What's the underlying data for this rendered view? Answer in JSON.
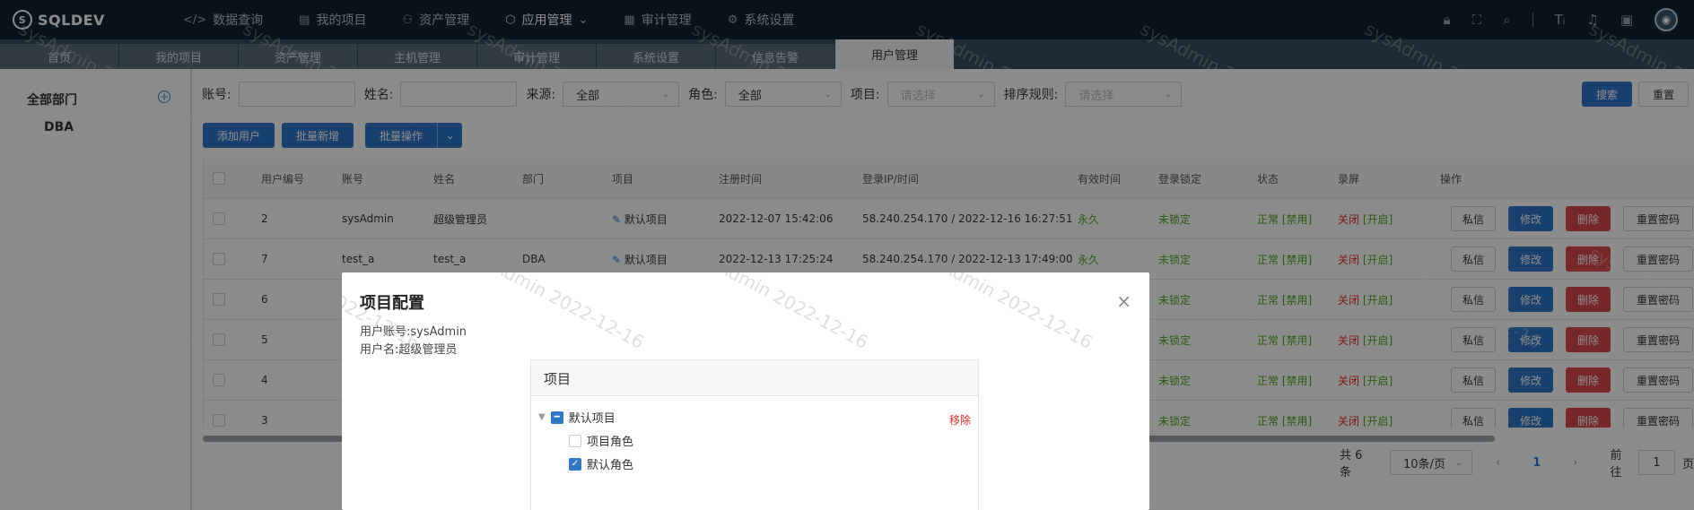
{
  "app": {
    "logo": "SQLDEV"
  },
  "nav": [
    {
      "label": "数据查询",
      "icon": "code-icon"
    },
    {
      "label": "我的项目",
      "icon": "document-icon"
    },
    {
      "label": "资产管理",
      "icon": "assets-icon"
    },
    {
      "label": "应用管理",
      "icon": "cube-icon"
    },
    {
      "label": "审计管理",
      "icon": "audit-icon"
    },
    {
      "label": "系统设置",
      "icon": "gear-icon"
    }
  ],
  "tabs": [
    "首页",
    "我的项目",
    "资产管理",
    "主机管理",
    "审计管理",
    "系统设置",
    "信息告警",
    "用户管理"
  ],
  "sidebar": {
    "title": "全部部门",
    "items": [
      "DBA"
    ]
  },
  "filters": {
    "account_label": "账号:",
    "name_label": "姓名:",
    "source_label": "来源:",
    "source_value": "全部",
    "role_label": "角色:",
    "role_value": "全部",
    "project_label": "项目:",
    "project_placeholder": "请选择",
    "sort_label": "排序规则:",
    "sort_placeholder": "请选择",
    "search_btn": "搜索",
    "reset_btn": "重置"
  },
  "actions": {
    "add_user": "添加用户",
    "batch_add": "批量新增",
    "batch_ops": "批量操作"
  },
  "table": {
    "headers": [
      "用户编号",
      "账号",
      "姓名",
      "部门",
      "项目",
      "注册时间",
      "登录IP/时间",
      "有效时间",
      "登录锁定",
      "状态",
      "录屏",
      "操作"
    ],
    "rows": [
      {
        "id": "2",
        "account": "sysAdmin",
        "name": "超级管理员",
        "dept": "",
        "project": "默认项目",
        "reg": "2022-12-07 15:42:06",
        "login": "58.240.254.170 / 2022-12-16 16:27:51",
        "valid": "永久",
        "lock": "未锁定",
        "status": "正常",
        "status_link": "[禁用]",
        "record": "关闭",
        "record_link": "[开启]"
      },
      {
        "id": "7",
        "account": "test_a",
        "name": "test_a",
        "dept": "DBA",
        "project": "默认项目",
        "reg": "2022-12-13 17:25:24",
        "login": "58.240.254.170 / 2022-12-13 17:49:00",
        "valid": "永久",
        "lock": "未锁定",
        "status": "正常",
        "status_link": "[禁用]",
        "record": "关闭",
        "record_link": "[开启]"
      },
      {
        "id": "6",
        "account": "",
        "name": "",
        "dept": "",
        "project": "",
        "reg": "",
        "login": "",
        "valid": "",
        "lock": "未锁定",
        "status": "正常",
        "status_link": "[禁用]",
        "record": "关闭",
        "record_link": "[开启]"
      },
      {
        "id": "5",
        "account": "",
        "name": "",
        "dept": "",
        "project": "",
        "reg": "",
        "login": "",
        "valid": "",
        "lock": "未锁定",
        "status": "正常",
        "status_link": "[禁用]",
        "record": "关闭",
        "record_link": "[开启]"
      },
      {
        "id": "4",
        "account": "",
        "name": "",
        "dept": "",
        "project": "",
        "reg": "",
        "login": "",
        "valid": "",
        "lock": "未锁定",
        "status": "正常",
        "status_link": "[禁用]",
        "record": "关闭",
        "record_link": "[开启]"
      },
      {
        "id": "3",
        "account": "",
        "name": "",
        "dept": "",
        "project": "",
        "reg": "",
        "login": "",
        "valid": "",
        "lock": "未锁定",
        "status": "正常",
        "status_link": "[禁用]",
        "record": "关闭",
        "record_link": "[开启]"
      }
    ],
    "row_buttons": {
      "message": "私信",
      "edit": "修改",
      "delete": "删除",
      "reset_pwd": "重置密码"
    }
  },
  "pager": {
    "total": "共 6 条",
    "page_size": "10条/页",
    "prev": "‹",
    "current": "1",
    "next": "›",
    "goto_label": "前往",
    "goto_value": "1",
    "page_suffix": "页"
  },
  "modal": {
    "title": "项目配置",
    "account_line": "用户账号:sysAdmin",
    "name_line": "用户名:超级管理员",
    "panel_title": "项目",
    "tree_root": "默认项目",
    "remove": "移除",
    "children": [
      {
        "label": "项目角色",
        "checked": false
      },
      {
        "label": "默认角色",
        "checked": true
      }
    ]
  },
  "watermark": "sysAdmin 2022-12-16"
}
